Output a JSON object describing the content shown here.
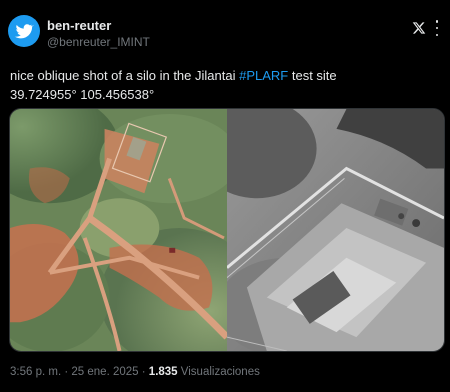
{
  "author": {
    "name": "ben-reuter",
    "handle": "@benreuter_IMINT",
    "avatar_icon": "twitter-bird-icon",
    "avatar_color": "#1d9bf0"
  },
  "header": {
    "platform_icon": "x-logo-icon",
    "more_icon": "more-options-icon"
  },
  "tweet": {
    "text_before": "nice oblique shot of a silo in the Jilantai ",
    "hashtag": "#PLARF",
    "text_after": " test site",
    "coordinates": "39.724955° 105.456538°"
  },
  "media": {
    "left_image": "satellite-color-terrain-image",
    "right_image": "satellite-grayscale-oblique-image"
  },
  "meta": {
    "time": "3:56 p. m.",
    "separator": "·",
    "date": "25 ene. 2025",
    "views_count": "1.835",
    "views_label": "Visualizaciones"
  },
  "colors": {
    "background": "#000000",
    "text": "#e7e9ea",
    "secondary": "#71767b",
    "accent": "#1d9bf0"
  }
}
